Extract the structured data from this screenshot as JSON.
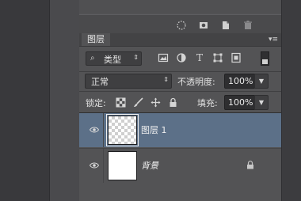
{
  "panel": {
    "tab_label": "图层",
    "kind_label": "类型",
    "blend_mode": "正常",
    "opacity_label": "不透明度:",
    "opacity_value": "100%",
    "lock_label": "锁定:",
    "fill_label": "填充:",
    "fill_value": "100%"
  },
  "layers": [
    {
      "name": "图层 1",
      "selected": true,
      "locked": false,
      "thumbnail": "transparent"
    },
    {
      "name": "背景",
      "selected": false,
      "locked": true,
      "thumbnail": "white"
    }
  ],
  "colors": {
    "panel_bg": "#535355",
    "selected_layer": "#5c7088",
    "field_bg": "#2e2e30"
  }
}
